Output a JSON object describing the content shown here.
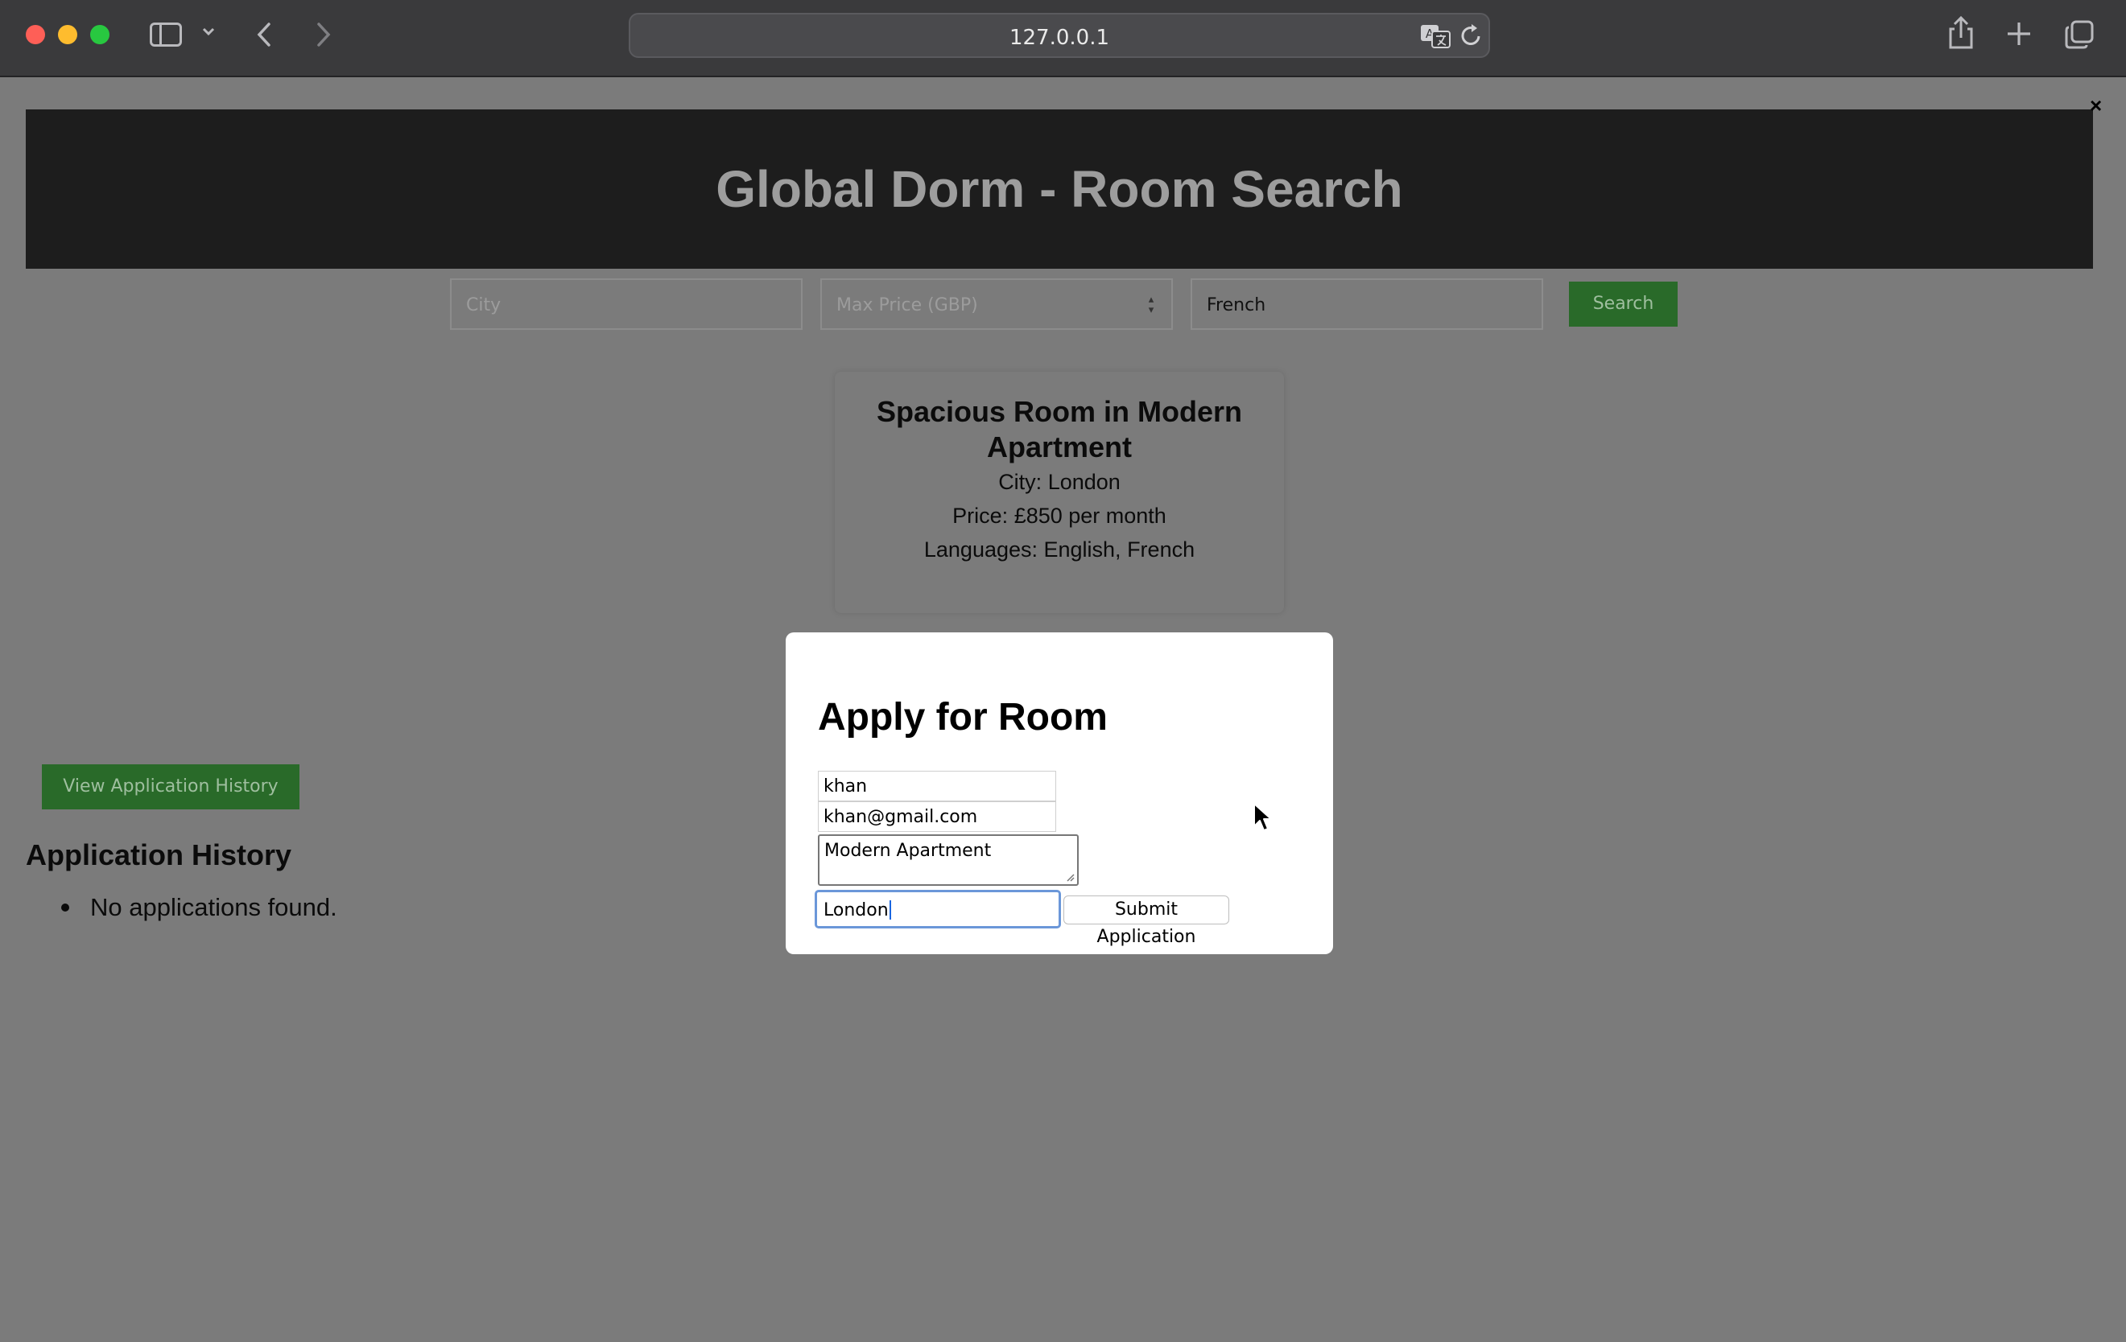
{
  "browser": {
    "url": "127.0.0.1"
  },
  "header": {
    "title": "Global Dorm - Room Search"
  },
  "search": {
    "city_placeholder": "City",
    "price_placeholder": "Max Price (GBP)",
    "language_value": "French",
    "button_label": "Search"
  },
  "room": {
    "title": "Spacious Room in Modern Apartment",
    "city": "City: London",
    "price": "Price: £850 per month",
    "languages": "Languages: English, French"
  },
  "close_label": "×",
  "history": {
    "button_label": "View Application History",
    "heading": "Application History",
    "items": [
      "No applications found."
    ]
  },
  "modal": {
    "title": "Apply for Room",
    "name_value": "khan",
    "email_value": "khan@gmail.com",
    "message_value": "Modern Apartment",
    "city_value": "London",
    "submit_label": "Submit Application"
  },
  "colors": {
    "accent_green": "#296a29",
    "focus_blue": "#6b97d9",
    "overlay": "#7b7b7b"
  },
  "icons": [
    "sidebar-icon",
    "chevron-down-icon",
    "back-icon",
    "forward-icon",
    "translate-icon",
    "reload-icon",
    "share-icon",
    "plus-icon",
    "tabs-overview-icon",
    "close-icon",
    "spinner-icon",
    "resize-handle-icon",
    "mouse-cursor-icon"
  ]
}
